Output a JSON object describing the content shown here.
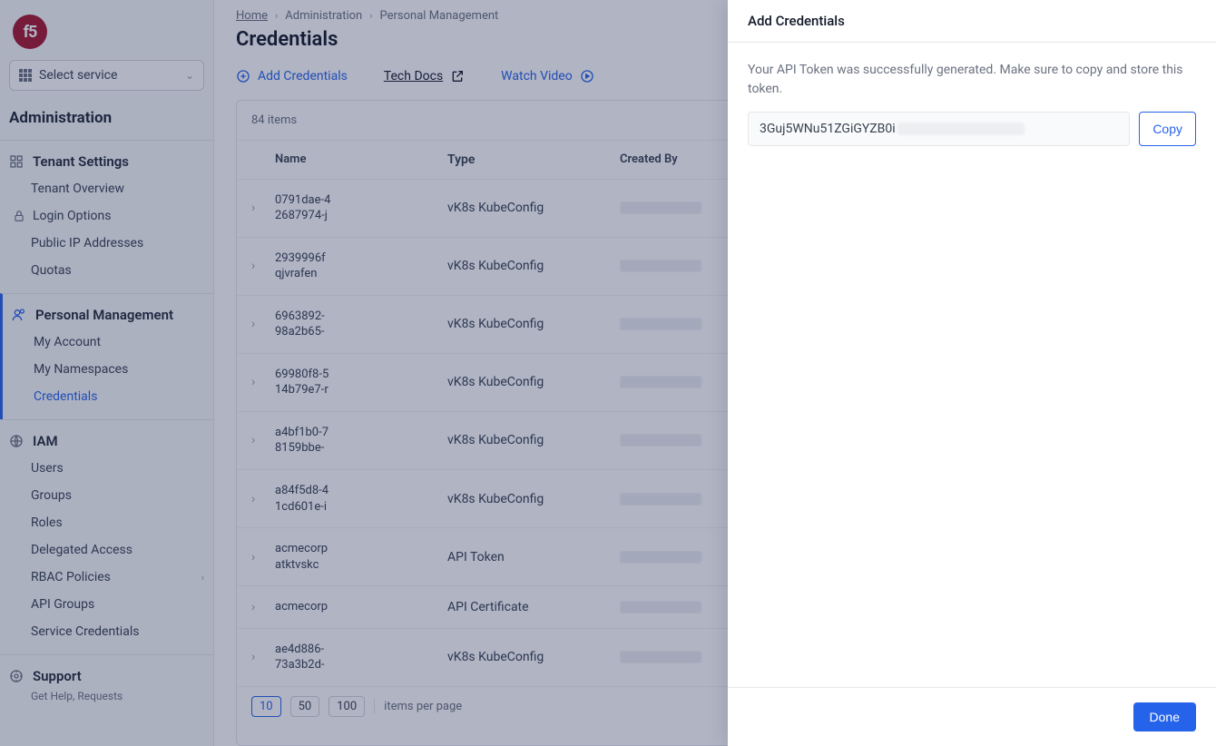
{
  "sidebar": {
    "service_select_label": "Select service",
    "title": "Administration",
    "sections": {
      "tenant": {
        "header": "Tenant Settings",
        "items": [
          {
            "label": "Tenant Overview"
          },
          {
            "label": "Login Options",
            "icon": "lock"
          },
          {
            "label": "Public IP Addresses"
          },
          {
            "label": "Quotas"
          }
        ]
      },
      "personal": {
        "header": "Personal Management",
        "items": [
          {
            "label": "My Account"
          },
          {
            "label": "My Namespaces"
          },
          {
            "label": "Credentials",
            "active": true
          }
        ]
      },
      "iam": {
        "header": "IAM",
        "items": [
          {
            "label": "Users"
          },
          {
            "label": "Groups"
          },
          {
            "label": "Roles"
          },
          {
            "label": "Delegated Access"
          },
          {
            "label": "RBAC Policies",
            "has_sub": true
          },
          {
            "label": "API Groups"
          },
          {
            "label": "Service Credentials"
          }
        ]
      },
      "support": {
        "header": "Support",
        "subtext": "Get Help, Requests"
      }
    }
  },
  "breadcrumb": {
    "home": "Home",
    "mid": "Administration",
    "last": "Personal Management"
  },
  "page_title": "Credentials",
  "actions": {
    "add": "Add Credentials",
    "docs": "Tech Docs",
    "video": "Watch Video"
  },
  "table": {
    "count_label": "84 items",
    "headers": {
      "name": "Name",
      "type": "Type",
      "created": "Created By"
    },
    "rows": [
      {
        "name_l1": "0791dae-4",
        "name_l2": "2687974-j",
        "type": "vK8s KubeConfig"
      },
      {
        "name_l1": "2939996f",
        "name_l2": "qjvrafen",
        "type": "vK8s KubeConfig"
      },
      {
        "name_l1": "6963892-",
        "name_l2": "98a2b65-",
        "type": "vK8s KubeConfig"
      },
      {
        "name_l1": "69980f8-5",
        "name_l2": "14b79e7-r",
        "type": "vK8s KubeConfig"
      },
      {
        "name_l1": "a4bf1b0-7",
        "name_l2": "8159bbe-",
        "type": "vK8s KubeConfig"
      },
      {
        "name_l1": "a84f5d8-4",
        "name_l2": "1cd601e-i",
        "type": "vK8s KubeConfig"
      },
      {
        "name_l1": "acmecorp",
        "name_l2": "atktvskc",
        "type": "API Token"
      },
      {
        "name_l1": "acmecorp",
        "name_l2": "",
        "type": "API Certificate"
      },
      {
        "name_l1": "ae4d886-",
        "name_l2": "73a3b2d-",
        "type": "vK8s KubeConfig"
      }
    ],
    "page_sizes": [
      "10",
      "50",
      "100"
    ],
    "page_size_label": "items per page"
  },
  "panel": {
    "title": "Add Credentials",
    "message": "Your API Token was successfully generated. Make sure to copy and store this token.",
    "token_preview": "3Guj5WNu51ZGiGYZB0i",
    "copy": "Copy",
    "done": "Done"
  }
}
